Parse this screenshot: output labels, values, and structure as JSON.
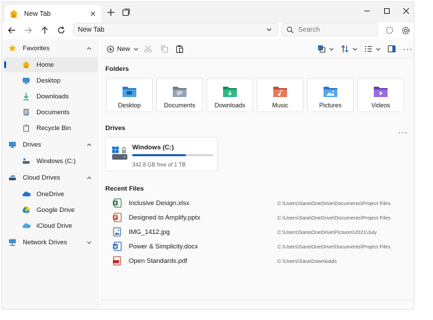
{
  "tab": {
    "title": "New Tab",
    "close": "✕"
  },
  "address": {
    "path": "New Tab"
  },
  "search": {
    "placeholder": "Search"
  },
  "sidebar": {
    "favorites": {
      "label": "Favorites",
      "items": [
        {
          "label": "Home",
          "icon": "home-icon"
        },
        {
          "label": "Desktop",
          "icon": "desktop-icon"
        },
        {
          "label": "Downloads",
          "icon": "download-icon"
        },
        {
          "label": "Documents",
          "icon": "documents-icon"
        },
        {
          "label": "Recycle Bin",
          "icon": "recycle-bin-icon"
        }
      ]
    },
    "drives": {
      "label": "Drives",
      "items": [
        {
          "label": "Windows (C:)",
          "icon": "drive-icon"
        }
      ]
    },
    "cloud": {
      "label": "Cloud Drives",
      "items": [
        {
          "label": "OneDrive",
          "icon": "onedrive-icon"
        },
        {
          "label": "Google Drive",
          "icon": "google-drive-icon"
        },
        {
          "label": "iCloud Drive",
          "icon": "icloud-icon"
        }
      ]
    },
    "network": {
      "label": "Network Drives"
    }
  },
  "toolbar": {
    "new_label": "New"
  },
  "sections": {
    "folders": "Folders",
    "drives": "Drives",
    "recent": "Recent Files"
  },
  "folders": [
    {
      "label": "Desktop",
      "icon": "desktop-folder-icon"
    },
    {
      "label": "Documents",
      "icon": "documents-folder-icon"
    },
    {
      "label": "Downloads",
      "icon": "downloads-folder-icon"
    },
    {
      "label": "Music",
      "icon": "music-folder-icon"
    },
    {
      "label": "Pictures",
      "icon": "pictures-folder-icon"
    },
    {
      "label": "Videos",
      "icon": "videos-folder-icon"
    }
  ],
  "drive": {
    "name": "Windows (C:)",
    "free": "342.8 GB free of 1 TB",
    "used_fraction": 0.66
  },
  "recent": [
    {
      "name": "Inclusive Design.xlsx",
      "path": "C:\\Users\\Sara\\OneDrive\\Documents\\Project Files",
      "icon": "excel-icon"
    },
    {
      "name": "Designed to Amplify.pptx",
      "path": "C:\\Users\\Sara\\OneDrive\\Documents\\Project Files",
      "icon": "powerpoint-icon"
    },
    {
      "name": "IMG_1412.jpg",
      "path": "C:\\Users\\Sara\\OneDrive\\Pictures\\2021\\July",
      "icon": "image-icon"
    },
    {
      "name": "Power & Simplicity.docx",
      "path": "C:\\Users\\Sara\\OneDrive\\Documents\\Project Files",
      "icon": "word-icon"
    },
    {
      "name": "Open Standards.pdf",
      "path": "C:\\Users\\Sara\\Downloads",
      "icon": "pdf-icon"
    }
  ],
  "colors": {
    "accent": "#1a5fb4",
    "folder": "#3a8fd4",
    "sidebar_bg": "#f7f7f7",
    "main_bg": "#fafafa"
  }
}
